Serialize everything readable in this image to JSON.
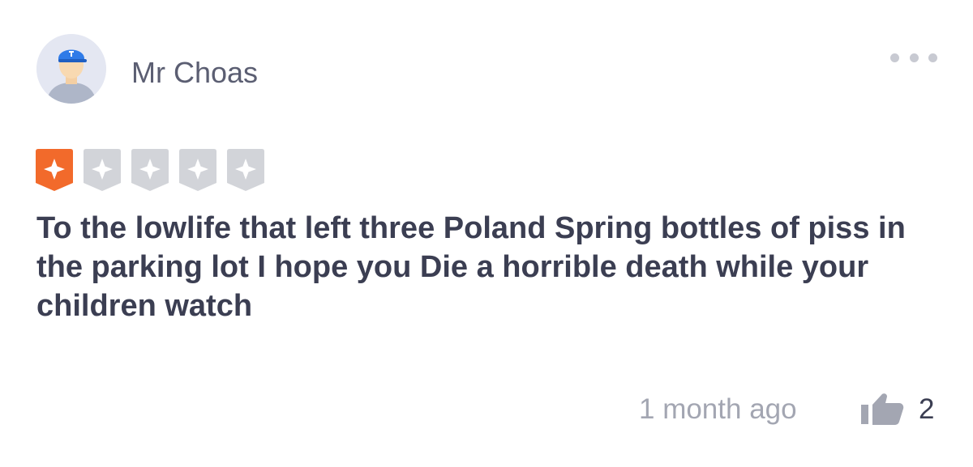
{
  "review": {
    "author": {
      "name": "Mr Choas",
      "avatar_icon": "user-avatar-cap-icon"
    },
    "more_icon": "more-horizontal-icon",
    "rating": {
      "value": 1,
      "max": 5,
      "filled_color": "#f26a2b",
      "empty_color": "#d2d4d9",
      "icon": "star-badge-icon"
    },
    "text": "To the lowlife that left three Poland Spring bottles of piss in the parking lot I hope you Die a horrible death while your children watch",
    "timestamp": "1 month ago",
    "likes": {
      "icon": "thumbs-up-icon",
      "count": "2"
    }
  }
}
